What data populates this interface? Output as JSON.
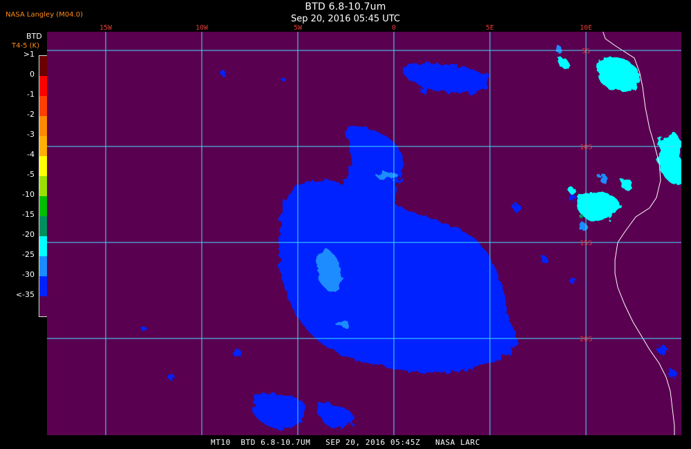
{
  "header": {
    "credit": "NASA Langley (M04.0)",
    "title": "BTD 6.8-10.7um",
    "subtitle": "Sep 20, 2016 05:45 UTC"
  },
  "colorbar": {
    "title": "BTD",
    "units": "T4-5 (K)",
    "labels": [
      ">1",
      "0",
      "-1",
      "-2",
      "-3",
      "-4",
      "-5",
      "-10",
      "-15",
      "-20",
      "-25",
      "-30",
      "<-35"
    ],
    "colors": [
      "#6b0000",
      "#ff0000",
      "#ff4000",
      "#ff8a00",
      "#ffb000",
      "#ffff00",
      "#9be000",
      "#00c000",
      "#009060",
      "#00ffff",
      "#1a8cff",
      "#0022ff",
      "#5a0050"
    ]
  },
  "map": {
    "background_color": "#5a0050",
    "grid_color": "#44e0ff",
    "coast_color": "#ffffff",
    "longitudes": [
      {
        "value": -15,
        "label": "15W"
      },
      {
        "value": -10,
        "label": "10W"
      },
      {
        "value": -5,
        "label": "5W"
      },
      {
        "value": 0,
        "label": "0"
      },
      {
        "value": 5,
        "label": "5E"
      },
      {
        "value": 10,
        "label": "10E"
      }
    ],
    "latitudes": [
      {
        "value": -5,
        "label": "5S"
      },
      {
        "value": -10,
        "label": "10S"
      },
      {
        "value": -15,
        "label": "15S"
      },
      {
        "value": -20,
        "label": "20S"
      }
    ]
  },
  "footer": {
    "text": "MT10  BTD 6.8-10.7UM   SEP 20, 2016 05:45Z   NASA LARC"
  }
}
